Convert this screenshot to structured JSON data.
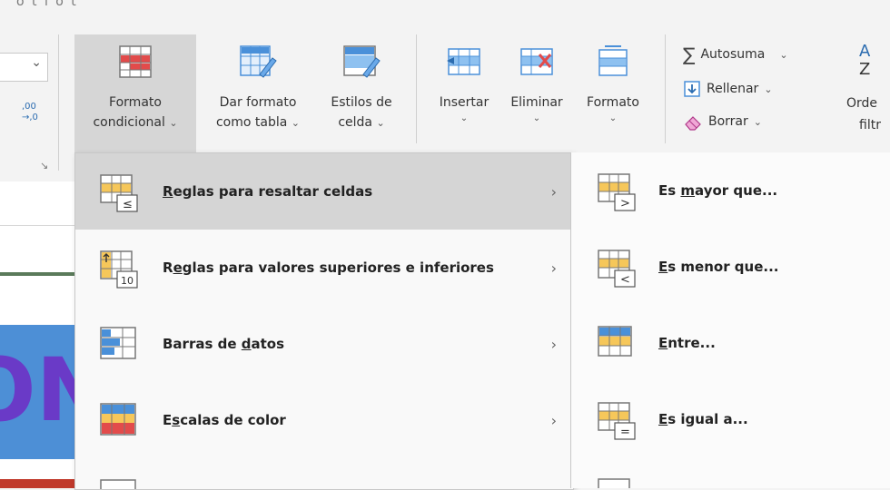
{
  "ribbon": {
    "top_partial_text": "o t i o t",
    "left_dropdown_caret": "⌄",
    "left_partial_label": ",00 →,0",
    "dialog_launcher": "↘",
    "buttons": [
      {
        "line1": "Formato",
        "line2": "condicional"
      },
      {
        "line1": "Dar formato",
        "line2": "como tabla"
      },
      {
        "line1": "Estilos de",
        "line2": "celda"
      }
    ],
    "cells": [
      {
        "line1": "Insertar"
      },
      {
        "line1": "Eliminar"
      },
      {
        "line1": "Formato"
      }
    ],
    "editing": {
      "autosum": "Autosuma",
      "fill": "Rellenar",
      "clear": "Borrar",
      "sort_line1": "Orde",
      "sort_line2": "filtr"
    }
  },
  "menu": {
    "items": [
      {
        "pre": "",
        "acc": "R",
        "post": "eglas para resaltar celdas"
      },
      {
        "pre": "R",
        "acc": "e",
        "post": "glas para valores superiores e inferiores"
      },
      {
        "pre": "Barras de ",
        "acc": "d",
        "post": "atos"
      },
      {
        "pre": "E",
        "acc": "s",
        "post": "calas de color"
      }
    ]
  },
  "submenu": {
    "items": [
      {
        "pre": "Es ",
        "acc": "m",
        "post": "ayor que..."
      },
      {
        "pre": "",
        "acc": "E",
        "post": "s menor que..."
      },
      {
        "pre": "",
        "acc": "E",
        "post": "ntre..."
      },
      {
        "pre": "",
        "acc": "E",
        "post": "s igual a..."
      }
    ]
  },
  "icons": {
    "sheet_text": "ON",
    "le": "≤",
    "gt": ">",
    "lt": "<",
    "eq": "=",
    "ten": "10"
  },
  "colors": {
    "highlight_red": "#e24b4b",
    "highlight_yellow": "#f6c75a",
    "table_blue": "#4a90d9",
    "grid_line": "#777777",
    "sheet_blue": "#4d8fd6",
    "sheet_purple": "#6a3ac7"
  }
}
